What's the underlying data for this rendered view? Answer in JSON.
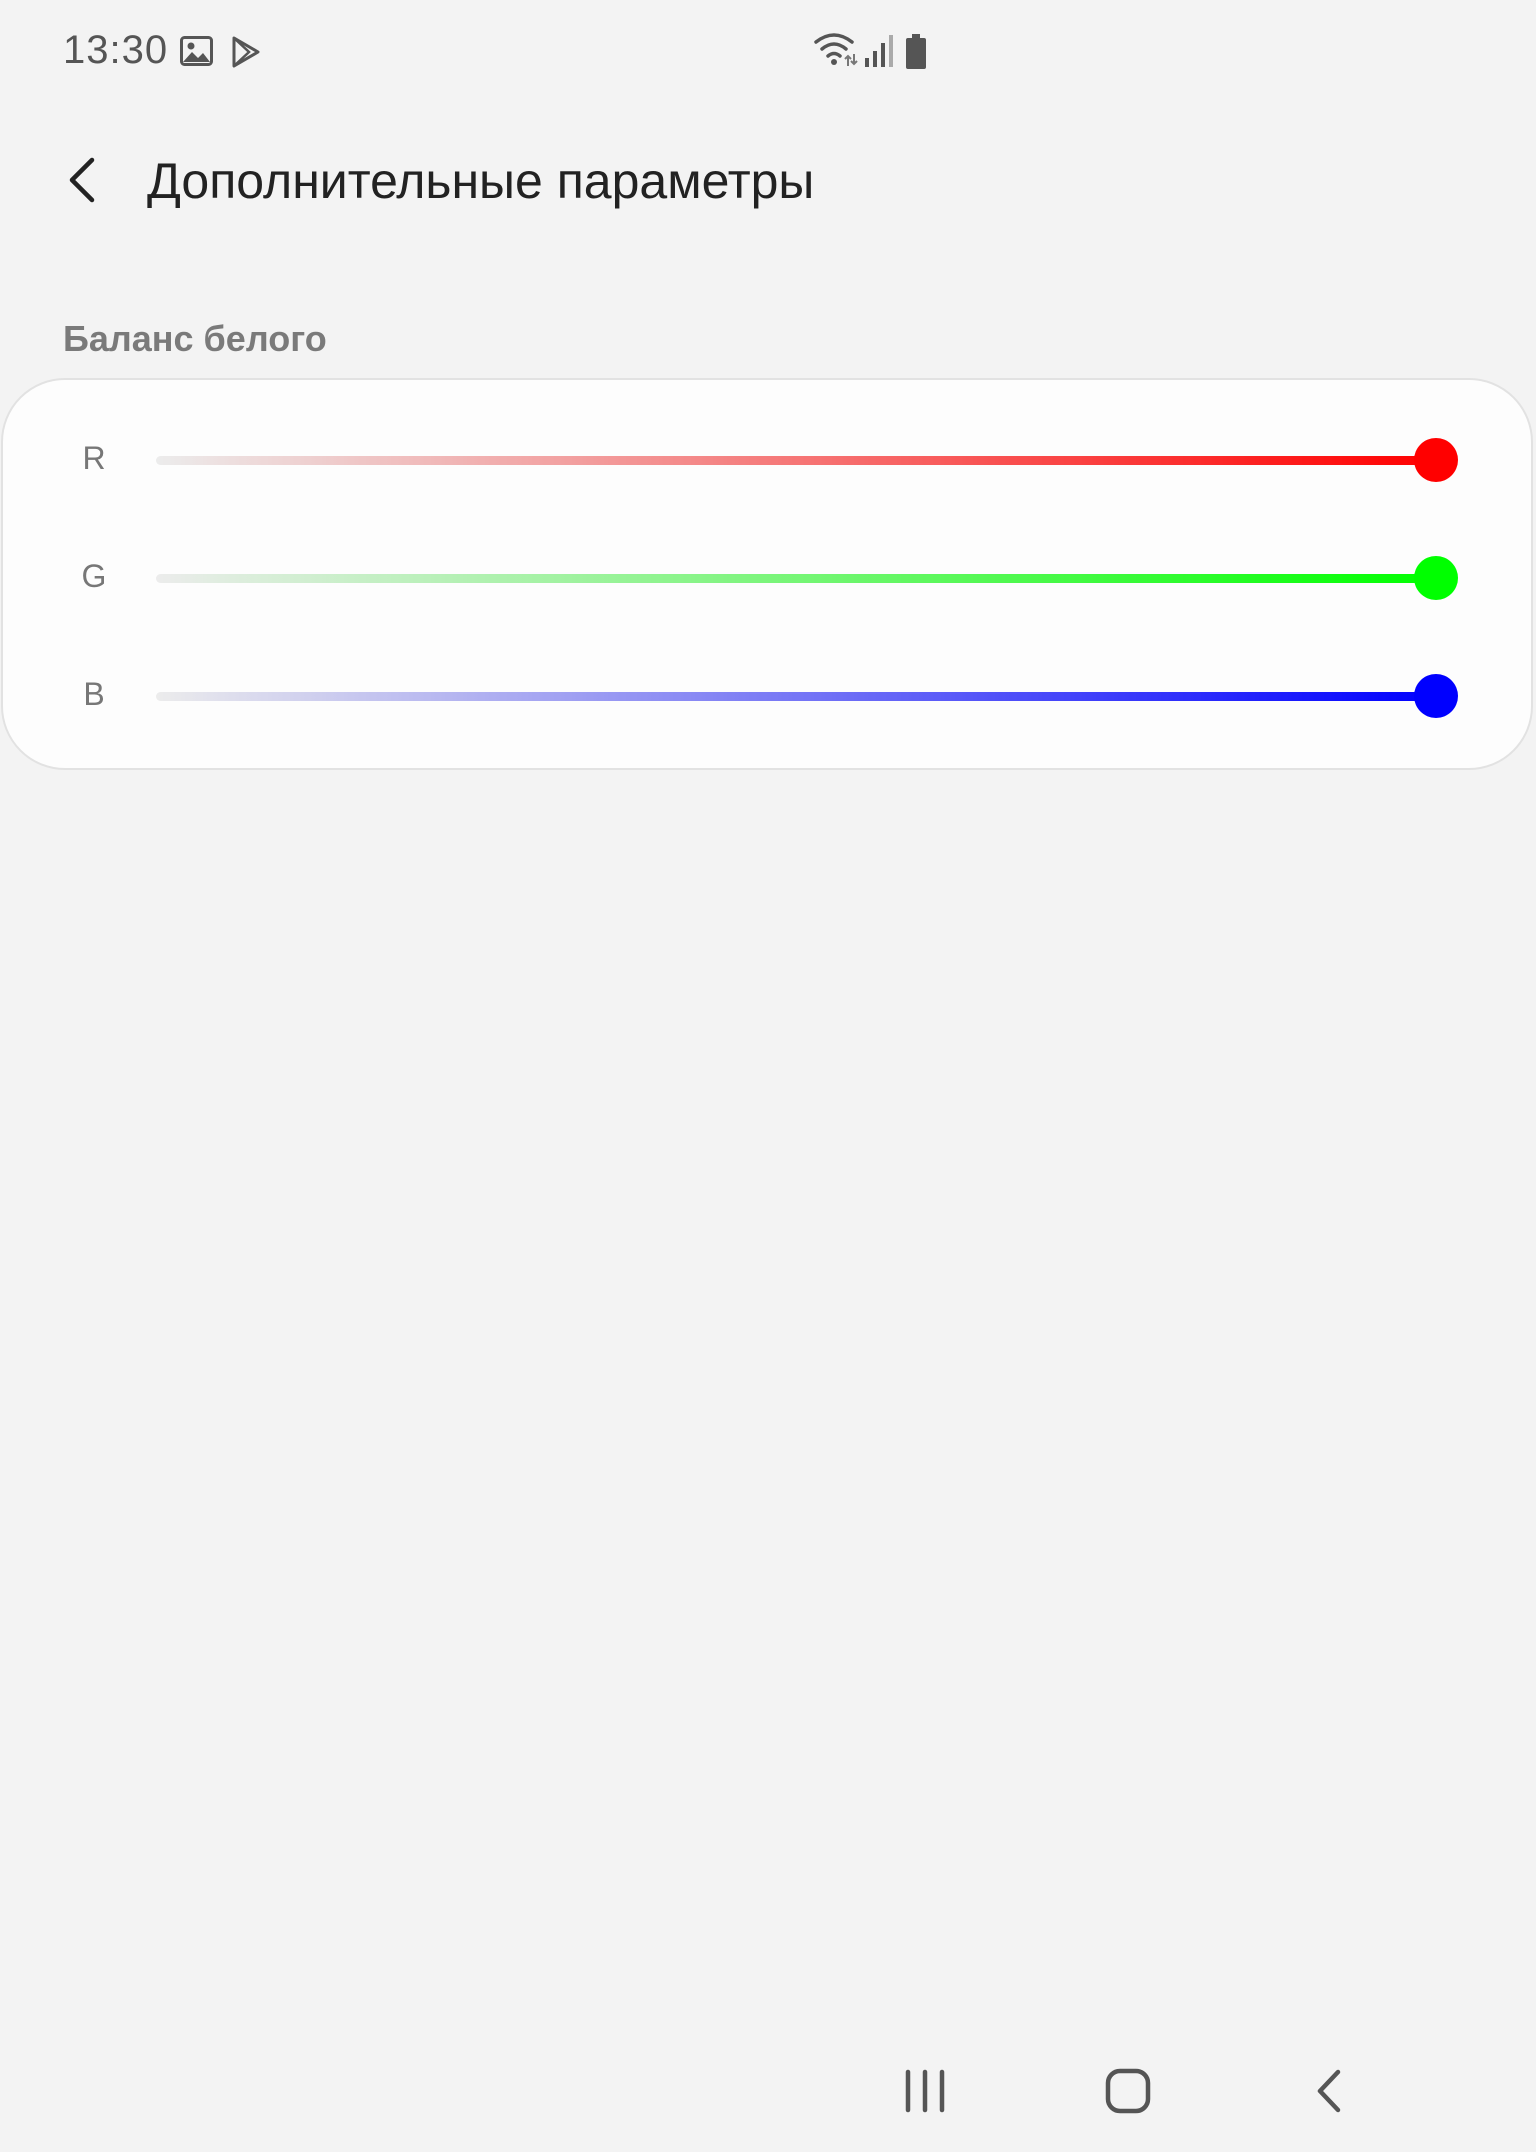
{
  "status_bar": {
    "time": "13:30",
    "icons": [
      "gallery-icon",
      "play-store-icon",
      "wifi-icon",
      "signal-icon",
      "battery-icon"
    ]
  },
  "header": {
    "title": "Дополнительные параметры",
    "back_icon": "chevron-left-icon"
  },
  "white_balance": {
    "section_title": "Баланс белого",
    "sliders": [
      {
        "label": "R",
        "color": "#ff0000",
        "value": 1.0
      },
      {
        "label": "G",
        "color": "#00ff00",
        "value": 1.0
      },
      {
        "label": "B",
        "color": "#0000ff",
        "value": 1.0
      }
    ]
  },
  "nav_bar": {
    "buttons": [
      "recent-apps-icon",
      "home-icon",
      "back-icon"
    ]
  },
  "colors": {
    "background": "#f3f3f3",
    "card": "#fdfdfd",
    "section_header": "#7a7a7a"
  }
}
